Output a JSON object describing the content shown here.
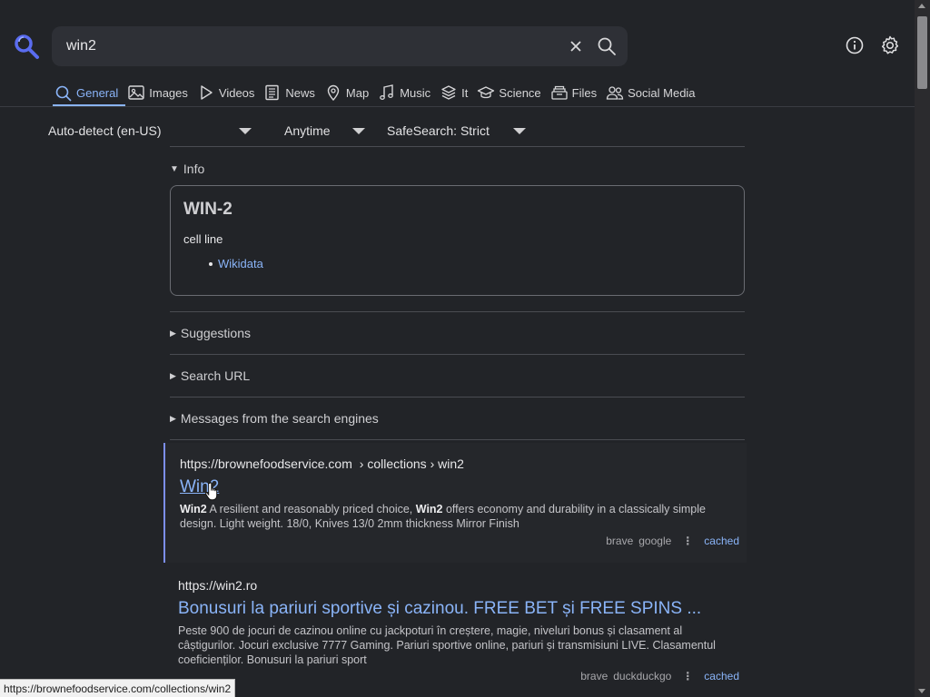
{
  "search": {
    "query": "win2"
  },
  "tabs": [
    {
      "label": "General",
      "icon": "search-icon",
      "active": true
    },
    {
      "label": "Images",
      "icon": "image-icon"
    },
    {
      "label": "Videos",
      "icon": "play-icon"
    },
    {
      "label": "News",
      "icon": "newspaper-icon"
    },
    {
      "label": "Map",
      "icon": "map-pin-icon"
    },
    {
      "label": "Music",
      "icon": "music-note-icon"
    },
    {
      "label": "It",
      "icon": "layers-icon"
    },
    {
      "label": "Science",
      "icon": "graduation-cap-icon"
    },
    {
      "label": "Files",
      "icon": "file-tray-icon"
    },
    {
      "label": "Social Media",
      "icon": "people-icon"
    }
  ],
  "filters": {
    "language": "Auto-detect (en-US)",
    "time": "Anytime",
    "safesearch": "SafeSearch: Strict"
  },
  "info": {
    "toggle": "Info",
    "title": "WIN-2",
    "description": "cell line",
    "link": "Wikidata"
  },
  "sections": {
    "suggestions": "Suggestions",
    "search_url": "Search URL",
    "messages": "Messages from the search engines"
  },
  "results": [
    {
      "url": "https://brownefoodservice.com",
      "path": "› collections › win2",
      "title": "Win2",
      "snippet_b1": "Win2",
      "snippet_t1": " A resilient and reasonably priced choice, ",
      "snippet_b2": "Win2",
      "snippet_t2": " offers economy and durability in a classically simple design. Light weight. 18/0, Knives 13/0 2mm thickness Mirror Finish",
      "engines": [
        "brave",
        "google"
      ],
      "cached": "cached"
    },
    {
      "url": "https://win2.ro",
      "title": "Bonusuri la pariuri sportive și cazinou. FREE BET și FREE SPINS ...",
      "snippet": "Peste 900 de jocuri de cazinou online cu jackpoturi în creștere, magie, niveluri bonus și clasament al câștigurilor. Jocuri exclusive 7777 Gaming. Pariuri sportive online, pariuri și transmisiuni LIVE. Clasamentul coeficienților. Bonusuri la pariuri sport",
      "engines": [
        "brave",
        "duckduckgo"
      ],
      "cached": "cached"
    }
  ],
  "status_bar": "https://brownefoodservice.com/collections/win2",
  "colors": {
    "accent": "#8ab4f8",
    "background": "#222428",
    "logo": "#5a6cf0"
  }
}
